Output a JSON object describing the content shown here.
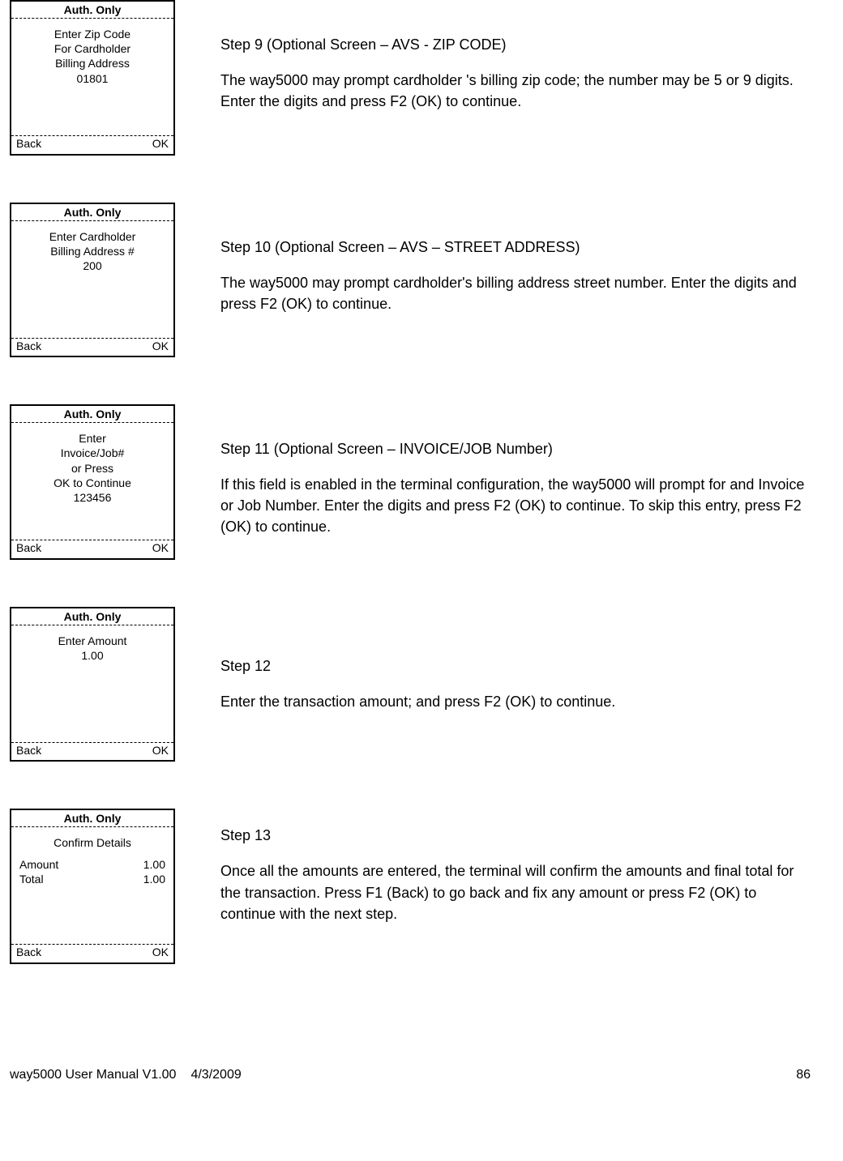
{
  "steps": [
    {
      "terminal": {
        "title": "Auth. Only",
        "lines": [
          "Enter Zip Code",
          "For Cardholder",
          "Billing Address",
          "01801"
        ],
        "left_btn": "Back",
        "right_btn": "OK"
      },
      "heading": "Step 9 (Optional Screen – AVS - ZIP CODE)",
      "body": "The way5000 may prompt cardholder 's billing zip code; the number may be 5 or 9 digits.  Enter the digits and press F2 (OK) to continue."
    },
    {
      "terminal": {
        "title": "Auth. Only",
        "lines": [
          "Enter Cardholder",
          "Billing Address #",
          "200"
        ],
        "left_btn": "Back",
        "right_btn": "OK"
      },
      "heading": "Step 10 (Optional Screen – AVS – STREET ADDRESS)",
      "body": "The way5000 may prompt cardholder's billing address street number. Enter the digits and press F2 (OK) to continue."
    },
    {
      "terminal": {
        "title": "Auth. Only",
        "lines": [
          "Enter",
          "Invoice/Job#",
          "or Press",
          "OK to Continue",
          "123456"
        ],
        "left_btn": "Back",
        "right_btn": "OK"
      },
      "heading": "Step 11 (Optional Screen – INVOICE/JOB Number)",
      "body": "If this field is enabled in the terminal configuration, the way5000 will prompt for and Invoice or Job Number. Enter the digits and press F2 (OK) to continue.   To skip this entry, press F2 (OK) to continue."
    },
    {
      "terminal": {
        "title": "Auth. Only",
        "lines": [
          "Enter Amount",
          "1.00"
        ],
        "left_btn": "Back",
        "right_btn": "OK"
      },
      "heading": "Step 12",
      "body": "Enter the transaction amount; and press F2 (OK) to continue."
    },
    {
      "terminal": {
        "title": "Auth. Only",
        "subtitle": "Confirm Details",
        "rows": [
          {
            "label": "Amount",
            "value": "1.00"
          },
          {
            "label": "Total",
            "value": "1.00"
          }
        ],
        "left_btn": "Back",
        "right_btn": "OK"
      },
      "heading": "Step 13",
      "body": "Once all the amounts are entered, the terminal will confirm the amounts and final total for the transaction. Press F1 (Back) to go back and fix any amount or press F2 (OK) to continue with the next step."
    }
  ],
  "footer": {
    "left": "way5000 User Manual V1.00",
    "center": "4/3/2009",
    "right": "86"
  }
}
